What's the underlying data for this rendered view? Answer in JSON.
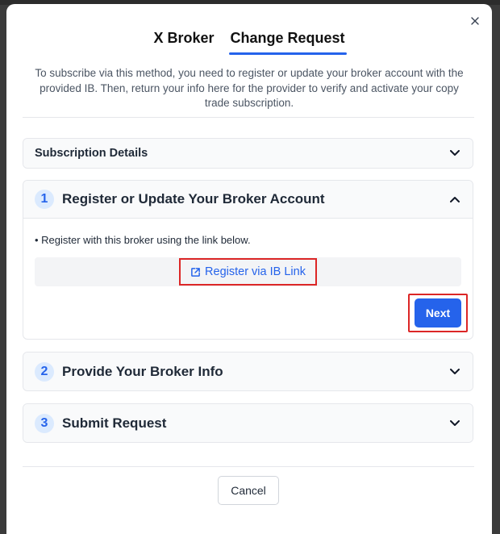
{
  "tabs": [
    {
      "label": "X Broker"
    },
    {
      "label": "Change Request"
    }
  ],
  "intro_text": "To subscribe via this method, you need to register or update your broker account with the provided IB. Then, return your info here for the provider to verify and activate your copy trade subscription.",
  "subscription_details": {
    "title": "Subscription Details"
  },
  "steps": [
    {
      "number": "1",
      "title": "Register or Update Your Broker Account"
    },
    {
      "number": "2",
      "title": "Provide Your Broker Info"
    },
    {
      "number": "3",
      "title": "Submit Request"
    }
  ],
  "step1": {
    "bullet": "• Register with this broker using the link below.",
    "link_label": "Register via IB Link",
    "next_label": "Next"
  },
  "footer": {
    "cancel_label": "Cancel"
  },
  "colors": {
    "accent": "#2563eb",
    "highlight": "#dc2626"
  },
  "icons": {
    "close": "close-icon",
    "chevron": "chevron-icon",
    "link": "external-link-icon"
  }
}
